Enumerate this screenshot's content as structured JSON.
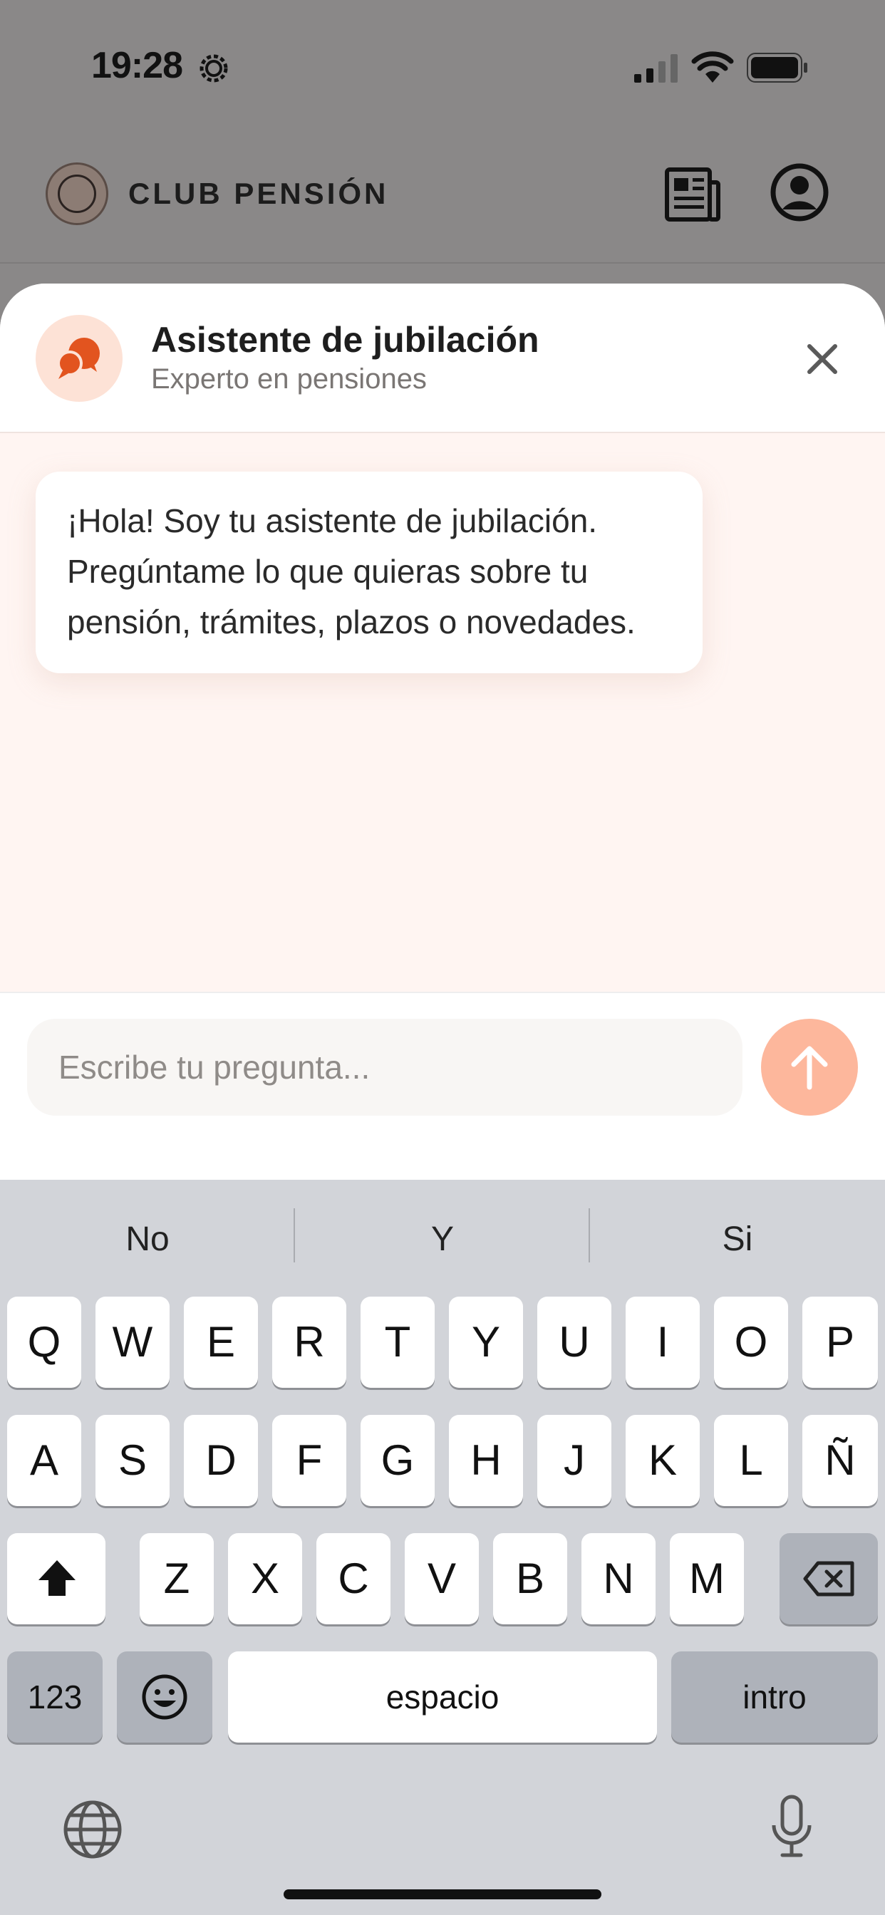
{
  "status_bar": {
    "time": "19:28",
    "icons": [
      "gear-icon",
      "signal-icon",
      "wifi-icon",
      "battery-icon"
    ]
  },
  "app_header": {
    "brand": "CLUB PENSIÓN",
    "icons": [
      "club-pension-logo",
      "news-icon",
      "user-icon"
    ]
  },
  "chat": {
    "title": "Asistente de jubilación",
    "subtitle": "Experto en pensiones",
    "messages": [
      {
        "from": "assistant",
        "text": "¡Hola! Soy tu asistente de jubilación. Pregúntame lo que quieras sobre tu pensión, trámites, plazos o novedades."
      }
    ],
    "input_placeholder": "Escribe tu pregunta...",
    "accent_color": "#e2541f",
    "send_color": "#fdb79c"
  },
  "keyboard": {
    "suggestions": [
      "No",
      "Y",
      "Si"
    ],
    "row1": [
      "Q",
      "W",
      "E",
      "R",
      "T",
      "Y",
      "U",
      "I",
      "O",
      "P"
    ],
    "row2": [
      "A",
      "S",
      "D",
      "F",
      "G",
      "H",
      "J",
      "K",
      "L",
      "Ñ"
    ],
    "row3": [
      "Z",
      "X",
      "C",
      "V",
      "B",
      "N",
      "M"
    ],
    "numbers_label": "123",
    "space_label": "espacio",
    "return_label": "intro"
  }
}
